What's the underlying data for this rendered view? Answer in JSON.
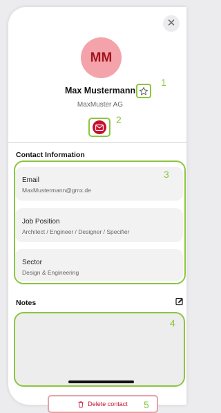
{
  "header": {
    "avatar_initials": "MM",
    "name": "Max Mustermann",
    "company": "MaxMuster AG"
  },
  "icons": {
    "close": "close-icon",
    "favorite": "star-icon",
    "email_action": "envelope-icon",
    "edit": "edit-icon",
    "delete": "trash-icon"
  },
  "annotations": [
    "1",
    "2",
    "3",
    "4",
    "5"
  ],
  "contact_info": {
    "title": "Contact Information",
    "fields": [
      {
        "label": "Email",
        "value": "MaxMustermann@gmx.de"
      },
      {
        "label": "Job Position",
        "value": "Architect / Engineer / Designer / Specifier"
      },
      {
        "label": "Sector",
        "value": "Design & Engineering"
      }
    ]
  },
  "notes": {
    "title": "Notes",
    "value": ""
  },
  "footer": {
    "delete_label": "Delete contact"
  },
  "colors": {
    "accent": "#c8102e",
    "avatar_bg": "#f5a3aa",
    "annotation": "#8cc63f"
  }
}
